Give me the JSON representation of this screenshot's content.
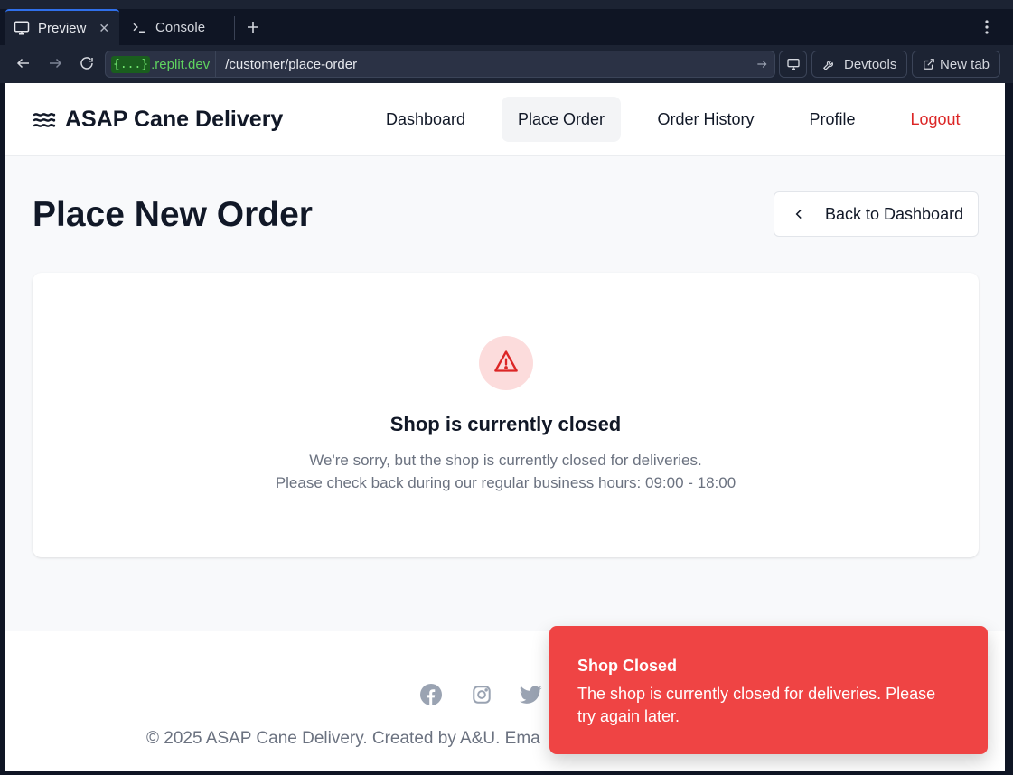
{
  "browser": {
    "tabs": [
      {
        "label": "Preview",
        "icon": "monitor-icon",
        "active": true
      },
      {
        "label": "Console",
        "icon": "terminal-icon",
        "active": false
      }
    ],
    "url": {
      "badge": "{...}",
      "domain": ".replit.dev",
      "path": "/customer/place-order"
    },
    "buttons": {
      "devtools": "Devtools",
      "new_tab": "New tab"
    }
  },
  "header": {
    "brand": "ASAP Cane Delivery",
    "nav": [
      {
        "label": "Dashboard",
        "active": false
      },
      {
        "label": "Place Order",
        "active": true
      },
      {
        "label": "Order History",
        "active": false
      },
      {
        "label": "Profile",
        "active": false
      },
      {
        "label": "Logout",
        "active": false
      }
    ]
  },
  "main": {
    "title": "Place New Order",
    "back_button": "Back to Dashboard",
    "notice": {
      "title": "Shop is currently closed",
      "line1": "We're sorry, but the shop is currently closed for deliveries.",
      "line2": "Please check back during our regular business hours: 09:00 - 18:00"
    }
  },
  "footer": {
    "social": [
      "facebook-icon",
      "instagram-icon",
      "twitter-icon"
    ],
    "copyright": "© 2025 ASAP Cane Delivery. Created by A&U. Ema"
  },
  "toast": {
    "title": "Shop Closed",
    "body": "The shop is currently closed for deliveries. Please try again later."
  },
  "colors": {
    "accent_red": "#ef4444",
    "logout_red": "#dc2626",
    "text_dark": "#111827",
    "text_muted": "#6b7280",
    "tab_active_border": "#2f6fea",
    "url_domain_green": "#5fd35f"
  }
}
